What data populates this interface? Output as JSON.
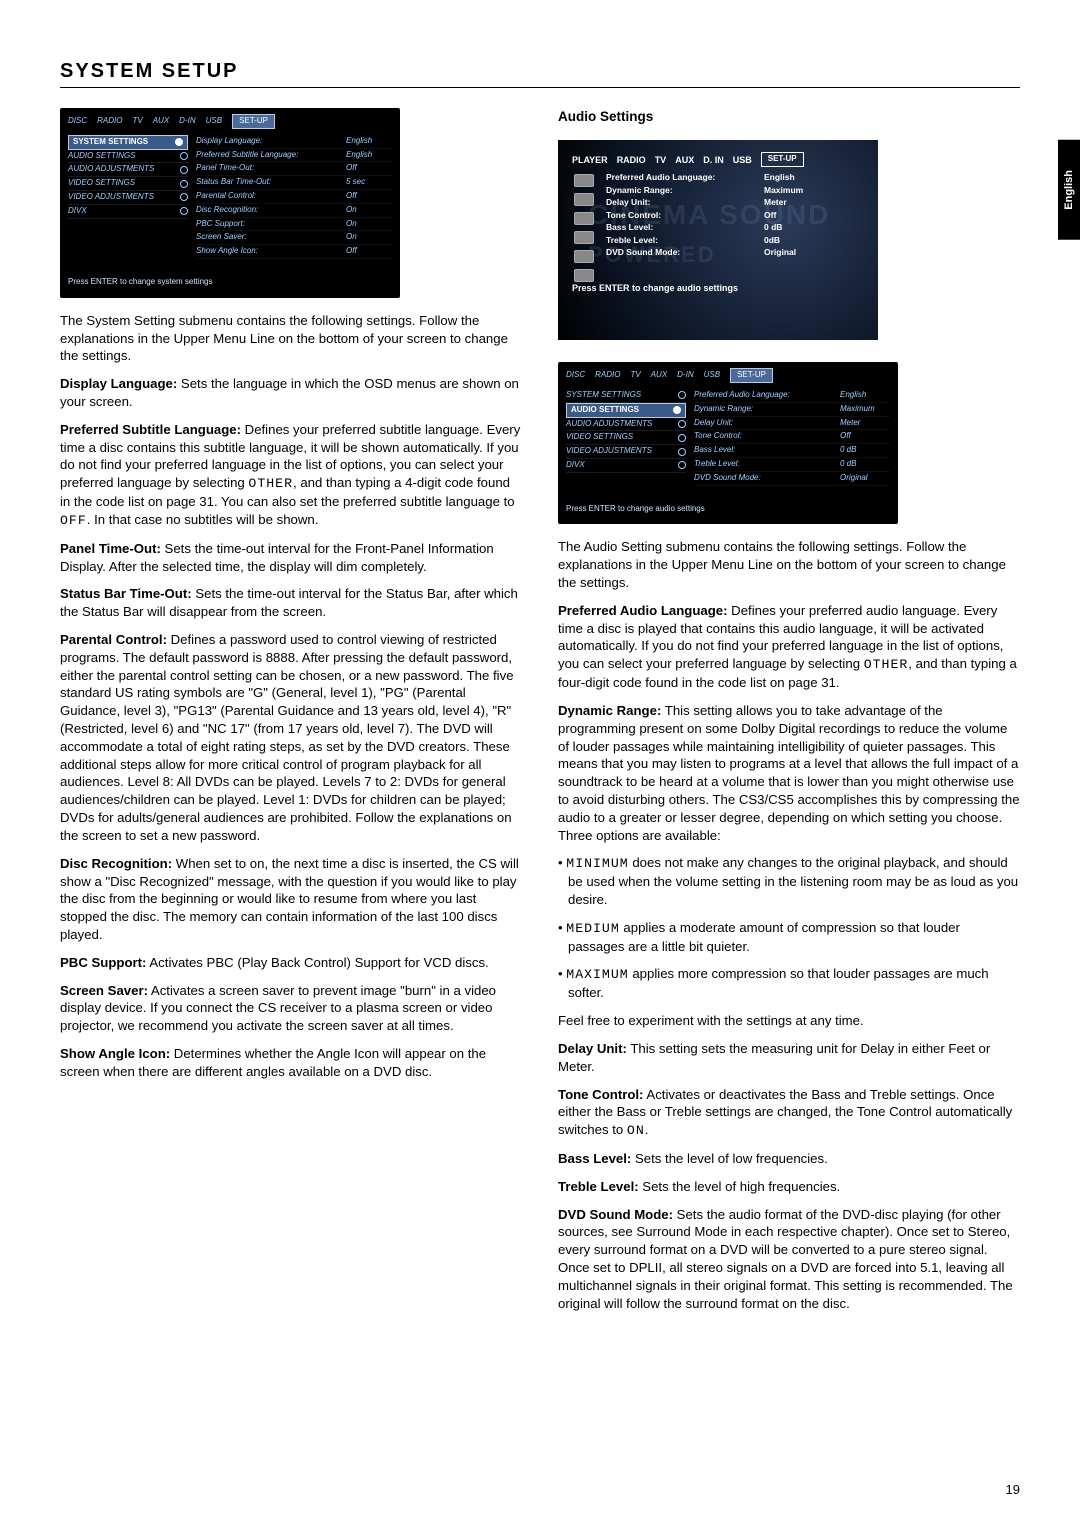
{
  "lang_tab": "English",
  "title": "SYSTEM SETUP",
  "page_number": "19",
  "osd1": {
    "tabs": [
      "DISC",
      "RADIO",
      "TV",
      "AUX",
      "D-IN",
      "USB",
      "SET-UP"
    ],
    "left": [
      "SYSTEM SETTINGS",
      "AUDIO SETTINGS",
      "AUDIO ADJUSTMENTS",
      "VIDEO SETTINGS",
      "VIDEO ADJUSTMENTS",
      "DIVX"
    ],
    "labels": [
      "Display Language:",
      "Preferred Subtitle Language:",
      "Panel Time-Out:",
      "Status Bar Time-Out:",
      "Parental Control:",
      "Disc Recognition:",
      "PBC Support:",
      "Screen Saver:",
      "Show Angle Icon:"
    ],
    "values": [
      "English",
      "English",
      "Off",
      "5 sec",
      "Off",
      "On",
      "On",
      "On",
      "Off"
    ],
    "footer": "Press ENTER to change system settings"
  },
  "left_paras": {
    "intro": "The System Setting submenu contains the following settings. Follow the explanations in the Upper Menu Line on the bottom of your screen to change the settings.",
    "display_language_t": "Display Language:",
    "display_language": " Sets the language in which the OSD menus are shown on your screen.",
    "pref_sub_t": "Preferred Subtitle Language:",
    "pref_sub": " Defines your preferred subtitle language. Every time a disc contains this subtitle language, it will be shown automatically. If you do not find your preferred language in the list of options, you can select your preferred language by selecting ",
    "pref_sub_code1": "OTHER",
    "pref_sub2": ", and than typing a 4-digit code found in the code list on page 31. You can also set the preferred subtitle language to ",
    "pref_sub_code2": "OFF",
    "pref_sub3": ". In that case no subtitles will be shown.",
    "panel_t": "Panel Time-Out:",
    "panel": " Sets the time-out interval for the Front-Panel Information Display. After the selected time, the display will dim completely.",
    "status_t": "Status Bar Time-Out:",
    "status": " Sets the time-out interval for the Status Bar, after which the Status Bar will disappear from the screen.",
    "parental_t": "Parental Control:",
    "parental": " Defines a password used to control viewing of restricted programs. The default password is 8888. After pressing the default password, either the parental control setting can be chosen, or a new password. The five standard US rating symbols are \"G\" (General, level 1), \"PG\" (Parental Guidance, level 3), \"PG13\" (Parental Guidance and 13 years old, level 4), \"R\" (Restricted, level 6) and \"NC 17\" (from 17 years old, level 7). The DVD will accommodate a total of eight rating steps, as set by the DVD creators. These additional steps allow for more critical control of program playback for all audiences. Level 8: All DVDs can be played. Levels 7 to 2: DVDs for general audiences/children can be played. Level 1: DVDs for children can be played; DVDs for adults/general audiences are prohibited. Follow the explanations on the screen to set a new password.",
    "disc_t": "Disc Recognition:",
    "disc": " When set to on, the next time a disc is inserted, the CS will show a \"Disc Recognized\" message, with the question if you would like to play the disc from the beginning or would like to resume from where you last stopped the disc. The memory can contain information of the last 100 discs played.",
    "pbc_t": "PBC Support:",
    "pbc": " Activates PBC (Play Back Control) Support for VCD discs.",
    "screen_t": "Screen Saver:",
    "screen": " Activates a screen saver to prevent image \"burn\" in a video display device. If you connect the CS receiver to a plasma screen or video projector, we recommend you activate the screen saver at all times.",
    "angle_t": "Show Angle Icon:",
    "angle": " Determines whether the Angle Icon will appear on the screen when there are different angles available on a DVD disc."
  },
  "right": {
    "heading": "Audio Settings",
    "photo": {
      "tabs": [
        "PLAYER",
        "RADIO",
        "TV",
        "AUX",
        "D. IN",
        "USB",
        "SET-UP"
      ],
      "labels": [
        "Preferred Audio Language:",
        "Dynamic Range:",
        "Delay Unit:",
        "Tone Control:",
        "Bass Level:",
        "Treble Level:",
        "DVD Sound Mode:"
      ],
      "values": [
        "English",
        "Maximum",
        "Meter",
        "Off",
        "0 dB",
        "0dB",
        "Original"
      ],
      "footer": "Press ENTER to change audio settings",
      "ghost1": "CINEMA SOUND",
      "ghost2": "POWERED"
    },
    "osd2": {
      "tabs": [
        "DISC",
        "RADIO",
        "TV",
        "AUX",
        "D-IN",
        "USB",
        "SET-UP"
      ],
      "left": [
        "SYSTEM SETTINGS",
        "AUDIO SETTINGS",
        "AUDIO ADJUSTMENTS",
        "VIDEO SETTINGS",
        "VIDEO ADJUSTMENTS",
        "DIVX"
      ],
      "labels": [
        "Preferred Audio Language:",
        "Dynamic Range:",
        "Delay Unit:",
        "Tone Control:",
        "Bass Level:",
        "Treble Level:",
        "DVD Sound Mode:"
      ],
      "values": [
        "English",
        "Maximum",
        "Meter",
        "Off",
        "0 dB",
        "0 dB",
        "Original"
      ],
      "footer": "Press ENTER to change audio settings"
    },
    "intro": "The Audio Setting submenu contains the following settings. Follow the explanations in the Upper Menu Line on the bottom of your screen to change the settings.",
    "pref_audio_t": "Preferred Audio Language:",
    "pref_audio": " Defines your preferred audio language. Every time a disc is played that contains this audio language, it will be activated automatically. If you do not find your preferred language in the list of options, you can select your preferred language by selecting ",
    "pref_audio_code": "OTHER",
    "pref_audio2": ", and than typing a four-digit code found in the code list on page 31.",
    "dyn_t": "Dynamic Range:",
    "dyn": " This setting allows you to take advantage of the programming present on some Dolby Digital recordings to reduce the volume of louder passages while maintaining intelligibility of quieter passages. This means that you may listen to programs at a level that allows the full impact of a soundtrack to be heard at a volume that is lower than you might otherwise use to avoid disturbing others. The CS3/CS5 accomplishes this by compressing the audio to a greater or lesser degree, depending on which setting you choose. Three options are available:",
    "b1a": "MINIMUM",
    "b1b": " does not make any changes to the original playback, and should be used when the volume setting in the listening room may be as loud as you desire.",
    "b2a": "MEDIUM",
    "b2b": " applies a moderate amount of compression so that louder passages are a little bit quieter.",
    "b3a": "MAXIMUM",
    "b3b": " applies more compression so that louder passages are much softer.",
    "experiment": "Feel free to experiment with the settings at any time.",
    "delay_t": "Delay Unit:",
    "delay": " This setting sets the measuring unit for Delay in either Feet or Meter.",
    "tone_t": "Tone Control:",
    "tone": " Activates or deactivates the Bass and Treble settings. Once either the Bass or Treble settings are changed, the Tone Control automatically switches to ",
    "tone_code": "ON",
    "tone2": ".",
    "bass_t": "Bass Level:",
    "bass": " Sets the level of low frequencies.",
    "treble_t": "Treble Level:",
    "treble": " Sets the level of high frequencies.",
    "dvd_t": "DVD Sound Mode:",
    "dvd": " Sets the audio format of the DVD-disc playing (for other sources, see Surround Mode in each respective chapter). Once set to Stereo, every surround format on a DVD will be converted to a pure stereo signal. Once set to DPLII, all stereo signals on a DVD are forced into 5.1, leaving all multichannel signals in their original format. This setting is recommended. The original will follow the surround format on the disc."
  }
}
